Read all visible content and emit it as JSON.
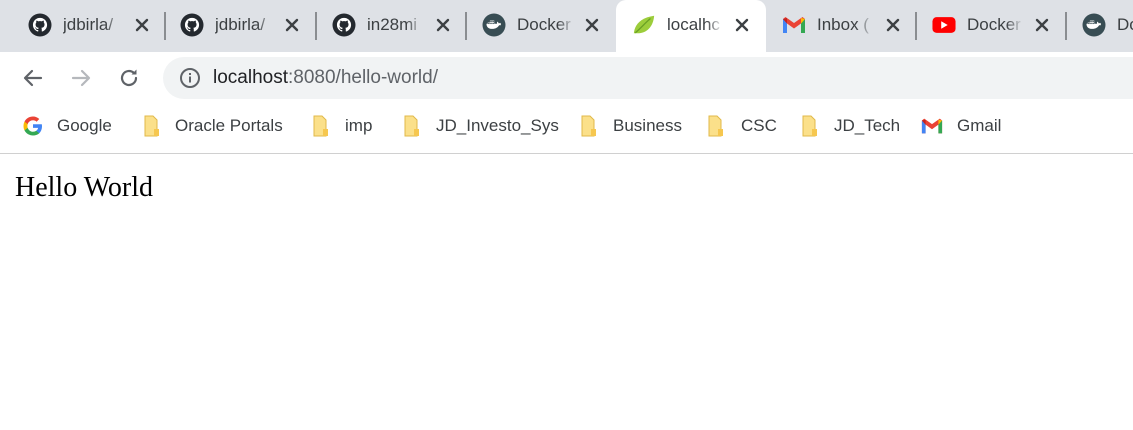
{
  "colors": {
    "tabstrip_bg": "#dee1e6",
    "active_tab_bg": "#ffffff",
    "omnibox_bg": "#f1f3f4",
    "text": "#3c4043",
    "folder": "#f9d97a"
  },
  "tabs": [
    {
      "title": "jdbirla/",
      "icon": "github-icon",
      "active": false
    },
    {
      "title": "jdbirla/",
      "icon": "github-icon",
      "active": false
    },
    {
      "title": "in28mi",
      "icon": "github-icon",
      "active": false
    },
    {
      "title": "Docker",
      "icon": "docker-icon",
      "active": false
    },
    {
      "title": "localhc",
      "icon": "spring-leaf-icon",
      "active": true
    },
    {
      "title": "Inbox (",
      "icon": "gmail-icon",
      "active": false
    },
    {
      "title": "Docker",
      "icon": "youtube-icon",
      "active": false
    },
    {
      "title": "Do",
      "icon": "docker-icon",
      "active": false
    }
  ],
  "toolbar": {
    "back_icon": "back-arrow-icon",
    "forward_icon": "forward-arrow-icon",
    "reload_icon": "reload-icon",
    "site_info_icon": "info-icon",
    "url_host": "localhost",
    "url_rest": ":8080/hello-world/"
  },
  "bookmarks": [
    {
      "label": "Google",
      "icon": "google-icon"
    },
    {
      "label": "Oracle Portals",
      "icon": "folder-icon"
    },
    {
      "label": "imp",
      "icon": "folder-icon"
    },
    {
      "label": "JD_Investo_Sys",
      "icon": "folder-icon"
    },
    {
      "label": "Business",
      "icon": "folder-icon"
    },
    {
      "label": "CSC",
      "icon": "folder-icon"
    },
    {
      "label": "JD_Tech",
      "icon": "folder-icon"
    },
    {
      "label": "Gmail",
      "icon": "gmail-icon"
    }
  ],
  "page": {
    "content": "Hello World"
  }
}
